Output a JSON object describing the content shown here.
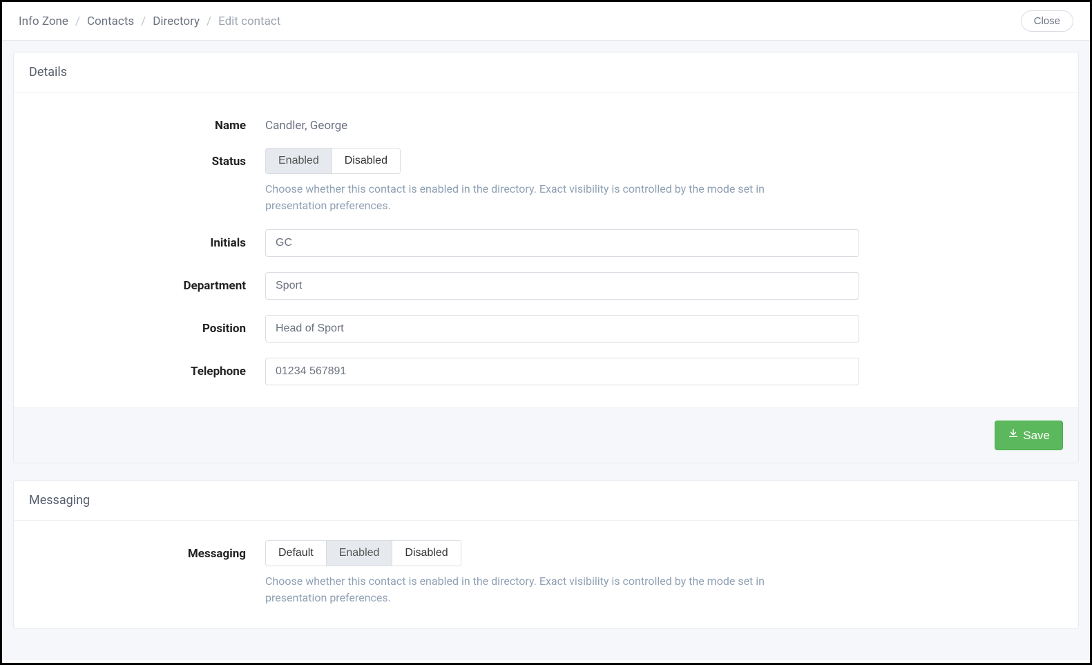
{
  "breadcrumb": {
    "items": [
      "Info Zone",
      "Contacts",
      "Directory"
    ],
    "current": "Edit contact"
  },
  "close_label": "Close",
  "details": {
    "heading": "Details",
    "name_label": "Name",
    "name_value": "Candler, George",
    "status_label": "Status",
    "status_options": {
      "enabled": "Enabled",
      "disabled": "Disabled"
    },
    "status_selected": "Enabled",
    "status_help": "Choose whether this contact is enabled in the directory. Exact visibility is controlled by the mode set in presentation preferences.",
    "initials_label": "Initials",
    "initials_value": "GC",
    "department_label": "Department",
    "department_value": "Sport",
    "position_label": "Position",
    "position_value": "Head of Sport",
    "telephone_label": "Telephone",
    "telephone_value": "01234 567891",
    "save_label": "Save"
  },
  "messaging": {
    "heading": "Messaging",
    "label": "Messaging",
    "options": {
      "default": "Default",
      "enabled": "Enabled",
      "disabled": "Disabled"
    },
    "selected": "Enabled",
    "help": "Choose whether this contact is enabled in the directory. Exact visibility is controlled by the mode set in presentation preferences."
  }
}
